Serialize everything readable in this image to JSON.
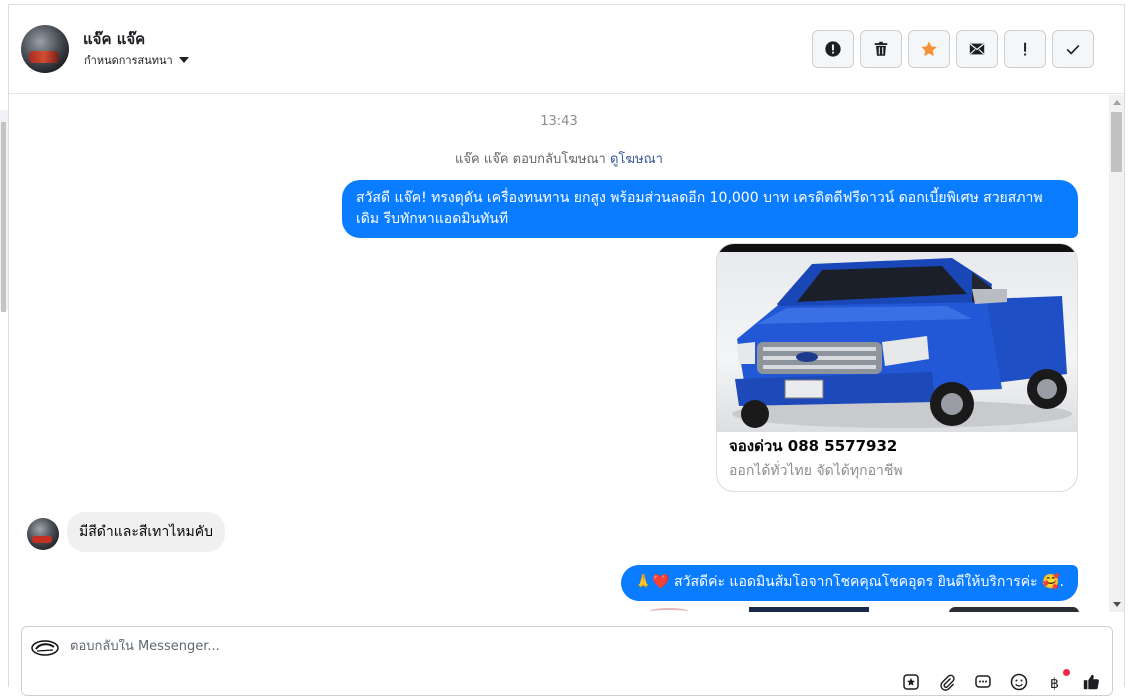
{
  "header": {
    "contact_name": "แจ๊ค แจ๊ค",
    "assign_label": "กำหนดการสนทนา",
    "actions": [
      {
        "name": "report-spam-button",
        "icon": "alert-circle-icon"
      },
      {
        "name": "delete-button",
        "icon": "trash-icon"
      },
      {
        "name": "star-button",
        "icon": "star-icon",
        "color": "#f7923b"
      },
      {
        "name": "mark-unread-button",
        "icon": "envelope-icon"
      },
      {
        "name": "follow-up-button",
        "icon": "exclamation-icon"
      },
      {
        "name": "mark-done-button",
        "icon": "check-icon"
      }
    ]
  },
  "thread": {
    "timestamp": "13:43",
    "ad_reply_text": "แจ๊ค แจ๊ค ตอบกลับโฆษณา",
    "ad_reply_link": "ดูโฆษณา",
    "messages": [
      {
        "direction": "out",
        "text": "สวัสดี แจ๊ค!  ทรงดุดัน เครื่องทนทาน ยกสูง พร้อมส่วนลดอีก 10,000 บาท เครดิตดีฟรีดาวน์ ดอกเบี้ยพิเศษ สวยสภาพเดิม รีบทักหาแอดมินทันที"
      },
      {
        "direction": "out",
        "type": "card",
        "title": "จองด่วน 088 5577932",
        "subtitle": "ออกได้ทั่วไทย จัดได้ทุกอาชีพ",
        "image": "blue-pickup-truck"
      },
      {
        "direction": "in",
        "text": "มีสีดำและสีเทาไหมคับ"
      },
      {
        "direction": "out",
        "text": "🙏❤️ สวัสดีค่ะ แอดมินส้มโอจากโชคคุณโชคอุดร ยินดีให้บริการค่ะ  🥰."
      }
    ]
  },
  "composer": {
    "placeholder": "ตอบกลับใน Messenger..."
  },
  "colors": {
    "accent": "#0a7cff",
    "incoming_bubble": "#f0f0f0",
    "notification_dot": "#f02849"
  }
}
